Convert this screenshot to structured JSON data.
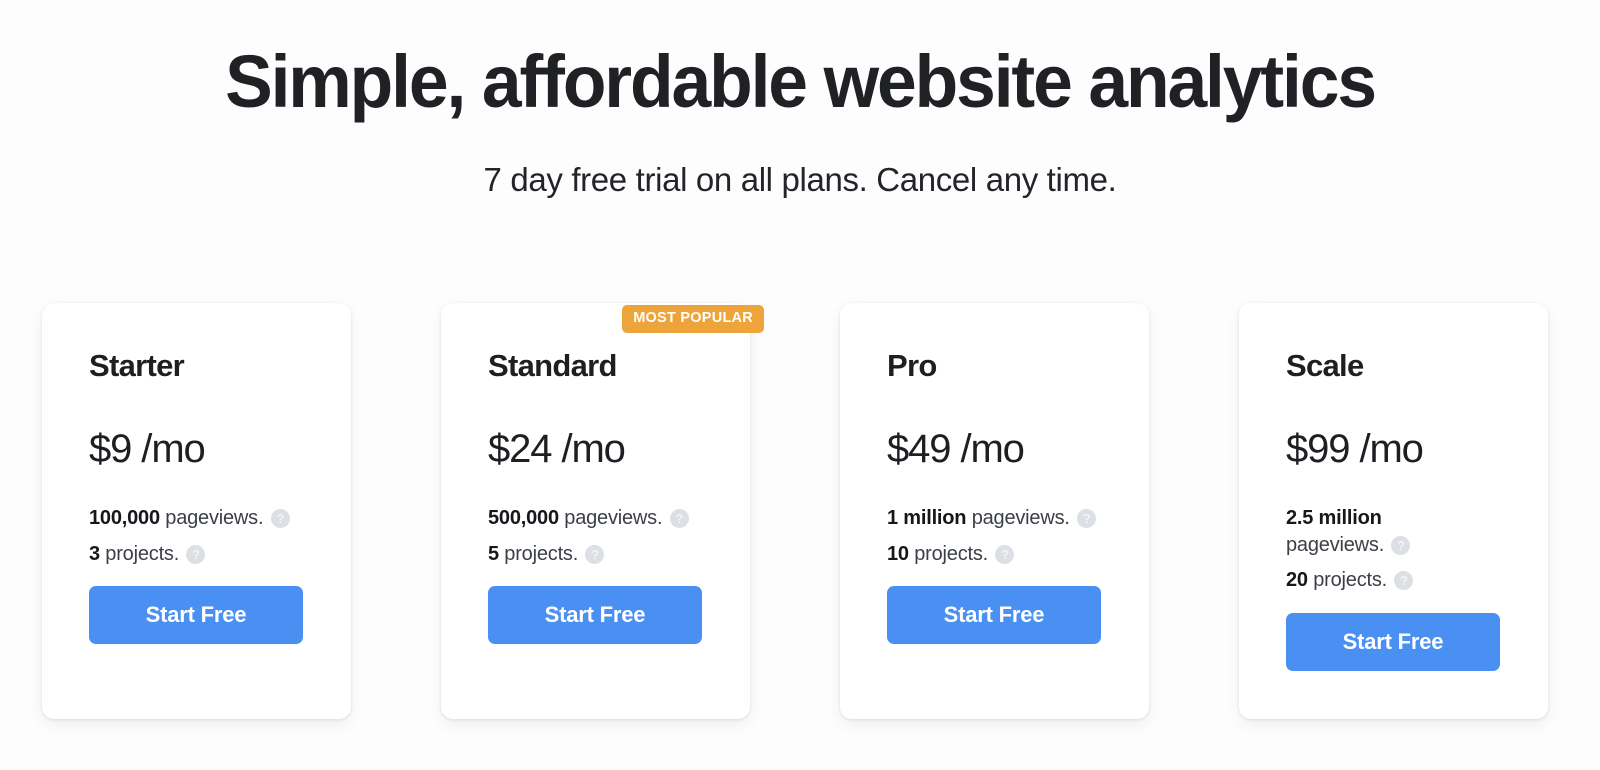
{
  "hero": {
    "title": "Simple, affordable website analytics",
    "subtitle": "7 day free trial on all plans. Cancel any time."
  },
  "colors": {
    "accent_button": "#4a90f2",
    "badge": "#eda43b",
    "page_background": "#fdfdfd",
    "card_background": "#ffffff",
    "text_primary": "#1d1f23",
    "help_icon": "#dcdfe3"
  },
  "icons": {
    "help": "?",
    "help_name": "help-icon"
  },
  "plans": [
    {
      "name": "Starter",
      "price": "$9 /mo",
      "badge": null,
      "pageviews_value": "100,000",
      "pageviews_label": "pageviews.",
      "projects_value": "3",
      "projects_label": "projects.",
      "cta": "Start Free"
    },
    {
      "name": "Standard",
      "price": "$24 /mo",
      "badge": "MOST POPULAR",
      "pageviews_value": "500,000",
      "pageviews_label": "pageviews.",
      "projects_value": "5",
      "projects_label": "projects.",
      "cta": "Start Free"
    },
    {
      "name": "Pro",
      "price": "$49 /mo",
      "badge": null,
      "pageviews_value": "1 million",
      "pageviews_label": "pageviews.",
      "projects_value": "10",
      "projects_label": "projects.",
      "cta": "Start Free"
    },
    {
      "name": "Scale",
      "price": "$99 /mo",
      "badge": null,
      "pageviews_value": "2.5 million",
      "pageviews_label": "pageviews.",
      "projects_value": "20",
      "projects_label": "projects.",
      "cta": "Start Free"
    }
  ]
}
